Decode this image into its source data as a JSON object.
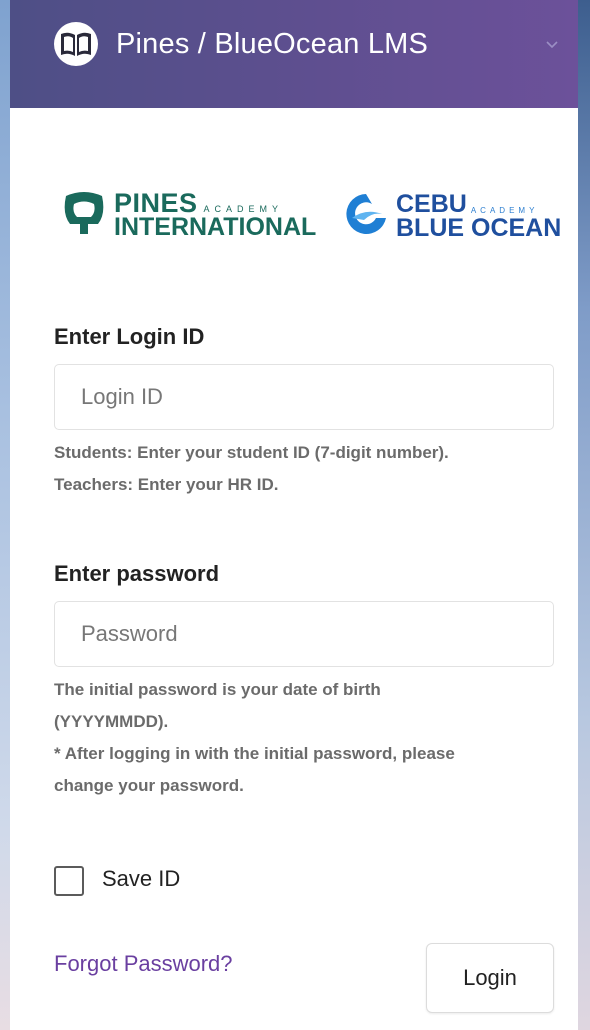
{
  "header": {
    "title": "Pines / BlueOcean LMS",
    "logo_icon": "open-book-icon",
    "menu_icon": "chevron-down-icon",
    "background": "#5a4f8e"
  },
  "brands": {
    "pines": {
      "line1": "PINES",
      "sub": "ACADEMY",
      "line2": "INTERNATIONAL",
      "color": "#1a6a5c"
    },
    "cebu": {
      "line1": "CEBU",
      "sub": "ACADEMY",
      "line2": "BLUE OCEAN",
      "color": "#1f4f9e"
    }
  },
  "login_id": {
    "label": "Enter Login ID",
    "placeholder": "Login ID",
    "value": "",
    "help_line1": "Students: Enter your student ID (7-digit number).",
    "help_line2": "Teachers: Enter your HR ID."
  },
  "password": {
    "label": "Enter password",
    "placeholder": "Password",
    "value": "",
    "help_line1": "The initial password is your date of birth",
    "help_line2": "(YYYYMMDD).",
    "help_line3": "* After logging in with the initial password, please",
    "help_line4": "change your password."
  },
  "save_id": {
    "label": "Save ID",
    "checked": false
  },
  "forgot_password": {
    "label": "Forgot Password?",
    "color": "#6a3fa0"
  },
  "login_button": {
    "label": "Login"
  }
}
